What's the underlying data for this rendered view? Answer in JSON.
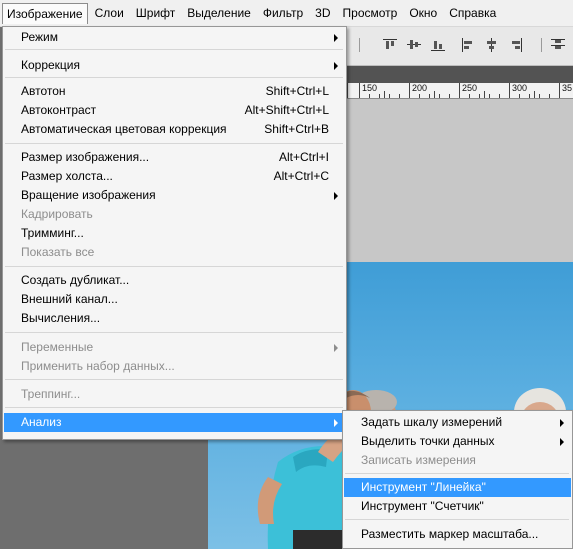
{
  "menubar": {
    "items": [
      "Изображение",
      "Слои",
      "Шрифт",
      "Выделение",
      "Фильтр",
      "3D",
      "Просмотр",
      "Окно",
      "Справка"
    ]
  },
  "ruler": {
    "labels": [
      "150",
      "200",
      "250",
      "300",
      "35"
    ]
  },
  "image_menu": {
    "items": [
      {
        "label": "Режим",
        "submenu": true
      },
      {
        "label": "Коррекция",
        "submenu": true
      },
      {
        "label": "Автотон",
        "shortcut": "Shift+Ctrl+L"
      },
      {
        "label": "Автоконтраст",
        "shortcut": "Alt+Shift+Ctrl+L"
      },
      {
        "label": "Автоматическая цветовая коррекция",
        "shortcut": "Shift+Ctrl+B"
      },
      {
        "label": "Размер изображения...",
        "shortcut": "Alt+Ctrl+I"
      },
      {
        "label": "Размер холста...",
        "shortcut": "Alt+Ctrl+C"
      },
      {
        "label": "Вращение изображения",
        "submenu": true
      },
      {
        "label": "Кадрировать",
        "disabled": true
      },
      {
        "label": "Тримминг..."
      },
      {
        "label": "Показать все",
        "disabled": true
      },
      {
        "label": "Создать дубликат..."
      },
      {
        "label": "Внешний канал..."
      },
      {
        "label": "Вычисления..."
      },
      {
        "label": "Переменные",
        "submenu": true,
        "disabled": true
      },
      {
        "label": "Применить набор данных...",
        "disabled": true
      },
      {
        "label": "Треппинг...",
        "disabled": true
      },
      {
        "label": "Анализ",
        "submenu": true,
        "highlighted": true
      }
    ]
  },
  "analysis_submenu": {
    "items": [
      {
        "label": "Задать шкалу измерений",
        "submenu": true
      },
      {
        "label": "Выделить точки данных",
        "submenu": true
      },
      {
        "label": "Записать измерения",
        "disabled": true
      },
      {
        "label": "Инструмент \"Линейка\"",
        "highlighted": true
      },
      {
        "label": "Инструмент \"Счетчик\""
      },
      {
        "label": "Разместить маркер масштаба..."
      }
    ]
  },
  "colors": {
    "highlight": "#3399ff",
    "menu_bg": "#f5f5f5",
    "disabled_text": "#8d8d8d",
    "sky": "#5aaee0"
  }
}
